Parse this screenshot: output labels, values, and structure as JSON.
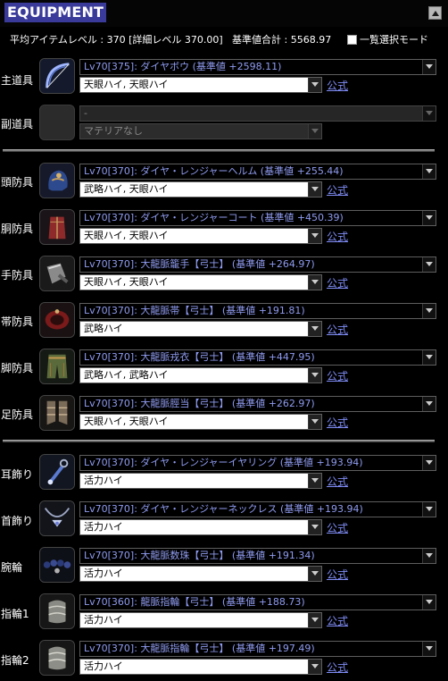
{
  "header": {
    "title": "EQUIPMENT"
  },
  "summary": {
    "avg_level": "平均アイテムレベル : 370 [詳細レベル 370.00]",
    "total": "基準値合計 : 5568.97",
    "mode_label": "一覧選択モード"
  },
  "slots": [
    {
      "label": "主道具",
      "item": "Lv70[375]: ダイヤボウ (基準値 +2598.11)",
      "sub": "天眼ハイ, 天眼ハイ",
      "link": "公式",
      "icon": "bow-icon"
    },
    {
      "label": "副道具",
      "item": "-",
      "sub": "マテリアなし",
      "link": "",
      "icon": "empty-slot-icon"
    },
    {
      "label": "頭防具",
      "item": "Lv70[370]: ダイヤ・レンジャーヘルム (基準値 +255.44)",
      "sub": "武略ハイ, 天眼ハイ",
      "link": "公式",
      "icon": "helm-icon"
    },
    {
      "label": "胴防具",
      "item": "Lv70[370]: ダイヤ・レンジャーコート (基準値 +450.39)",
      "sub": "天眼ハイ, 天眼ハイ",
      "link": "公式",
      "icon": "coat-icon"
    },
    {
      "label": "手防具",
      "item": "Lv70[370]: 大龍脈籠手【弓士】 (基準値 +264.97)",
      "sub": "天眼ハイ, 天眼ハイ",
      "link": "公式",
      "icon": "gloves-icon"
    },
    {
      "label": "帯防具",
      "item": "Lv70[370]: 大龍脈帯【弓士】 (基準値 +191.81)",
      "sub": "武略ハイ",
      "link": "公式",
      "icon": "belt-icon"
    },
    {
      "label": "脚防具",
      "item": "Lv70[370]: 大龍脈戎衣【弓士】 (基準値 +447.95)",
      "sub": "武略ハイ, 武略ハイ",
      "link": "公式",
      "icon": "pants-icon"
    },
    {
      "label": "足防具",
      "item": "Lv70[370]: 大龍脈脛当【弓士】 (基準値 +262.97)",
      "sub": "天眼ハイ, 天眼ハイ",
      "link": "公式",
      "icon": "boots-icon"
    },
    {
      "label": "耳飾り",
      "item": "Lv70[370]: ダイヤ・レンジャーイヤリング (基準値 +193.94)",
      "sub": "活力ハイ",
      "link": "公式",
      "icon": "earring-icon"
    },
    {
      "label": "首飾り",
      "item": "Lv70[370]: ダイヤ・レンジャーネックレス (基準値 +193.94)",
      "sub": "活力ハイ",
      "link": "公式",
      "icon": "necklace-icon"
    },
    {
      "label": "腕輪",
      "item": "Lv70[370]: 大龍脈数珠【弓士】 (基準値 +191.34)",
      "sub": "活力ハイ",
      "link": "公式",
      "icon": "bracelet-icon"
    },
    {
      "label": "指輪1",
      "item": "Lv70[360]: 龍脈指輪【弓士】 (基準値 +188.73)",
      "sub": "活力ハイ",
      "link": "公式",
      "icon": "ring-icon"
    },
    {
      "label": "指輪2",
      "item": "Lv70[370]: 大龍脈指輪【弓士】 (基準値 +197.49)",
      "sub": "活力ハイ",
      "link": "公式",
      "icon": "ring-icon"
    }
  ]
}
